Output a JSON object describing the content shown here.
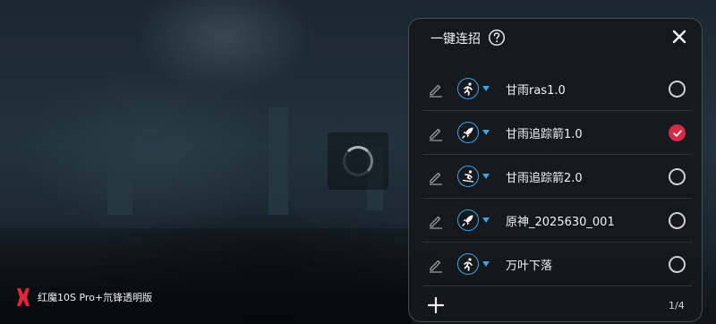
{
  "background": {
    "brand_text": "红魔10S Pro+氘锋透明版"
  },
  "panel": {
    "title": "一键连招",
    "page_indicator": "1/4",
    "items": [
      {
        "label": "甘雨ras1.0",
        "mode_icon": "running-person-icon",
        "selected": false
      },
      {
        "label": "甘雨追踪箭1.0",
        "mode_icon": "rocket-icon",
        "selected": true
      },
      {
        "label": "甘雨追踪箭2.0",
        "mode_icon": "skiing-person-icon",
        "selected": false
      },
      {
        "label": "原神_2025630_001",
        "mode_icon": "rocket-icon",
        "selected": false
      },
      {
        "label": "万叶下落",
        "mode_icon": "running-person-icon",
        "selected": false
      }
    ]
  },
  "colors": {
    "accent_blue": "#3fa3e8",
    "selected_red": "#d52b46",
    "panel_bg": "#16181b"
  }
}
